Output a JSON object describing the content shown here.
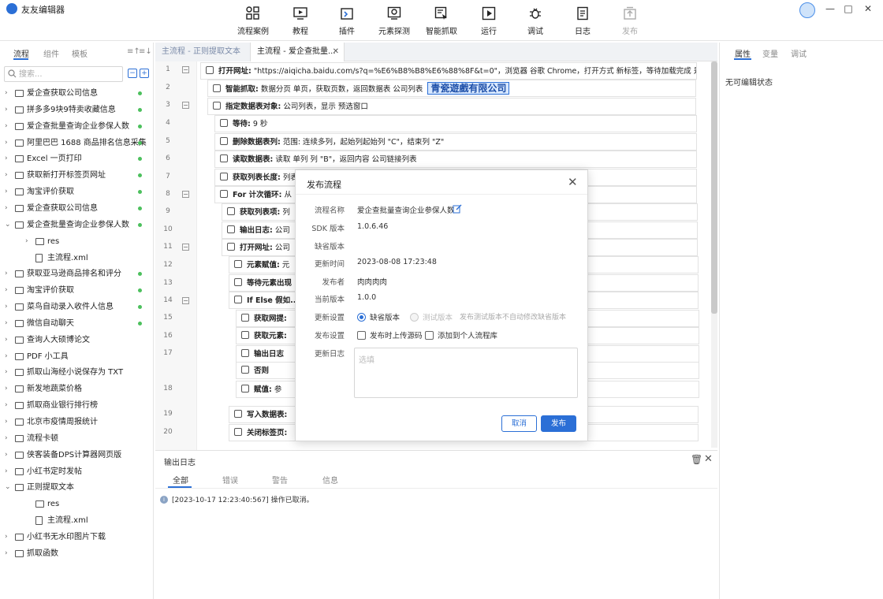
{
  "app": {
    "title": "友友编辑器"
  },
  "toolbar": [
    {
      "label": "流程案例",
      "icon": "flow-cases-icon"
    },
    {
      "label": "教程",
      "icon": "video-tutorial-icon"
    },
    {
      "label": "插件",
      "icon": "plugin-icon"
    },
    {
      "label": "元素探测",
      "icon": "element-detect-icon"
    },
    {
      "label": "智能抓取",
      "icon": "smart-grab-icon"
    },
    {
      "label": "运行",
      "icon": "run-icon"
    },
    {
      "label": "调试",
      "icon": "debug-icon"
    },
    {
      "label": "日志",
      "icon": "log-icon"
    },
    {
      "label": "发布",
      "icon": "publish-icon",
      "disabled": true
    }
  ],
  "window_controls": {
    "minimize": "—",
    "maximize": "□",
    "close": "✕"
  },
  "left_panel": {
    "tabs": [
      "流程",
      "组件",
      "模板"
    ],
    "search_placeholder": "搜索...",
    "tree": [
      {
        "label": "爱企查获取公司信息",
        "type": "folder",
        "expand": "collapsed",
        "dot": true
      },
      {
        "label": "拼多多9块9特卖收藏信息",
        "type": "folder",
        "expand": "collapsed",
        "dot": true
      },
      {
        "label": "爱企查批量查询企业参保人数",
        "type": "folder-checked",
        "expand": "collapsed",
        "dot": true
      },
      {
        "label": "阿里巴巴 1688 商品排名信息采集",
        "type": "folder",
        "expand": "collapsed",
        "dot": true
      },
      {
        "label": "Excel 一页打印",
        "type": "folder",
        "expand": "collapsed",
        "dot": true
      },
      {
        "label": "获取新打开标签页网址",
        "type": "folder",
        "expand": "collapsed",
        "dot": true
      },
      {
        "label": "淘宝评价获取",
        "type": "folder",
        "expand": "collapsed",
        "dot": true
      },
      {
        "label": "爱企查获取公司信息",
        "type": "folder",
        "expand": "collapsed",
        "dot": true
      },
      {
        "label": "爱企查批量查询企业参保人数",
        "type": "folder-open",
        "expand": "expanded",
        "dot": true
      },
      {
        "label": "res",
        "type": "folder",
        "expand": "collapsed",
        "indent": 1
      },
      {
        "label": "主流程.xml",
        "type": "xml",
        "expand": "none",
        "indent": 1
      },
      {
        "label": "获取亚马逊商品排名和评分",
        "type": "folder",
        "expand": "collapsed",
        "dot": true
      },
      {
        "label": "淘宝评价获取",
        "type": "folder",
        "expand": "collapsed",
        "dot": true
      },
      {
        "label": "菜鸟自动录入收件人信息",
        "type": "folder",
        "expand": "collapsed",
        "dot": true
      },
      {
        "label": "微信自动聊天",
        "type": "folder",
        "expand": "collapsed",
        "dot": true
      },
      {
        "label": "查询人大硕博论文",
        "type": "folder",
        "expand": "collapsed"
      },
      {
        "label": "PDF 小工具",
        "type": "folder",
        "expand": "collapsed"
      },
      {
        "label": "抓取山海经小说保存为 TXT",
        "type": "folder",
        "expand": "collapsed"
      },
      {
        "label": "新发地蔬菜价格",
        "type": "folder",
        "expand": "collapsed"
      },
      {
        "label": "抓取商业银行排行榜",
        "type": "folder",
        "expand": "collapsed"
      },
      {
        "label": "北京市疫情周报统计",
        "type": "folder",
        "expand": "collapsed"
      },
      {
        "label": "流程卡顿",
        "type": "folder",
        "expand": "collapsed"
      },
      {
        "label": "侠客装备DPS计算器网页版",
        "type": "folder",
        "expand": "collapsed"
      },
      {
        "label": "小红书定时发帖",
        "type": "folder",
        "expand": "collapsed"
      },
      {
        "label": "正则提取文本",
        "type": "folder-checked",
        "expand": "expanded"
      },
      {
        "label": "res",
        "type": "folder",
        "expand": "none",
        "indent": 1
      },
      {
        "label": "主流程.xml",
        "type": "xml",
        "expand": "none",
        "indent": 1
      },
      {
        "label": "小红书无水印图片下载",
        "type": "folder",
        "expand": "collapsed"
      },
      {
        "label": "抓取函数",
        "type": "folder",
        "expand": "collapsed"
      }
    ]
  },
  "editor_tabs": [
    {
      "label": "主流程 - 正则提取文本",
      "active": false
    },
    {
      "label": "主流程 - 爱企查批量...",
      "active": true
    }
  ],
  "editor": {
    "line_numbers": [
      "1",
      "2",
      "3",
      "4",
      "5",
      "6",
      "7",
      "8",
      "9",
      "10",
      "11",
      "12",
      "13",
      "14",
      "15",
      "16",
      "17",
      "18",
      "19",
      "20"
    ],
    "steps": [
      {
        "label": "打开网址:",
        "text": " \"https://aiqicha.baidu.com/s?q=%E6%B8%B8%E6%88%8F&t=0\"，浏览器 谷歌 Chrome，打开方式 新标签，等待加载完成 是，完成后关闭..."
      },
      {
        "label": "智能抓取:",
        "text": " 数据分页 单页，获取页数，返回数据表 公司列表",
        "highlight": "青瓷遊戲有限公司"
      },
      {
        "label": "指定数据表对象:",
        "text": " 公司列表，显示 预选窗口"
      },
      {
        "label": "等待:",
        "text": " 9 秒"
      },
      {
        "label": "删除数据表列:",
        "text": " 范围: 连续多列，起始列起始列 \"C\"，结束列 \"Z\""
      },
      {
        "label": "读取数据表:",
        "text": " 读取 单列 列 \"B\"，返回内容 公司链接列表"
      },
      {
        "label": "获取列表长度:",
        "text": " 列表"
      },
      {
        "label": "For 计次循环:",
        "text": " 从"
      },
      {
        "label": "获取列表项:",
        "text": " 列"
      },
      {
        "label": "输出日志:",
        "text": " 公司"
      },
      {
        "label": "打开网址:",
        "text": " 公司"
      },
      {
        "label": "元素赋值:",
        "text": " 元"
      },
      {
        "label": "等待元素出现",
        "text": ""
      },
      {
        "label": "If Else 假如...",
        "text": ""
      },
      {
        "label": "获取网提:",
        "text": ""
      },
      {
        "label": "获取元素:",
        "text": ""
      },
      {
        "label": "输出日志",
        "text": ""
      },
      {
        "label": "否则",
        "text": ""
      },
      {
        "label": "赋值:",
        "text": " 参"
      },
      {
        "label": "写入数据表:",
        "text": ""
      },
      {
        "label": "关闭标签页:",
        "text": ""
      }
    ]
  },
  "log_panel": {
    "title": "输出日志",
    "tabs": [
      "全部",
      "错误",
      "警告",
      "信息"
    ],
    "entries": [
      "[2023-10-17 12:23:40:567] 操作已取消。"
    ]
  },
  "right_panel": {
    "tabs": [
      "属性",
      "变量",
      "调试"
    ],
    "empty_text": "无可编辑状态"
  },
  "dialog": {
    "title": "发布流程",
    "fields": [
      {
        "label": "流程名称",
        "value": "爱企查批量查询企业参保人数"
      },
      {
        "label": "SDK 版本",
        "value": "1.0.6.46"
      },
      {
        "label": "缺省版本",
        "value": ""
      },
      {
        "label": "更新时间",
        "value": "2023-08-08 17:23:48"
      },
      {
        "label": "发布者",
        "value": "肉肉肉肉"
      },
      {
        "label": "当前版本",
        "value": "1.0.0"
      }
    ],
    "update_setting_label": "更新设置",
    "update_options": [
      "缺省版本",
      "测试版本"
    ],
    "update_selected": "缺省版本",
    "update_hint": "发布测试版本不自动修改缺省版本",
    "publish_setting_label": "发布设置",
    "publish_options": [
      "发布时上传源码",
      "添加到个人流程库"
    ],
    "changelog_label": "更新日志",
    "changelog_placeholder": "选填",
    "cancel_label": "取消",
    "publish_label": "发布"
  },
  "colors": {
    "accent": "#2b6fd6",
    "status_ok": "#4cc05d"
  }
}
